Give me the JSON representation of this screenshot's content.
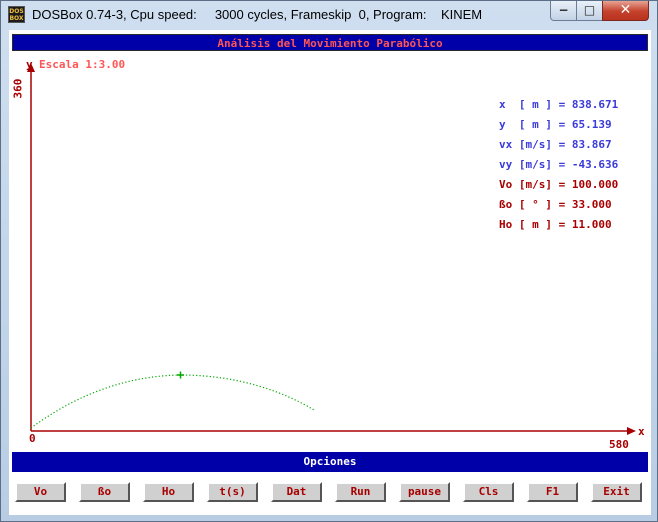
{
  "window": {
    "icon_text": "DOS BOX",
    "title": "DOSBox 0.74-3, Cpu speed:     3000 cycles, Frameskip  0, Program:    KINEM",
    "controls": [
      "minimize",
      "maximize",
      "close"
    ],
    "minimize_glyph": "−",
    "maximize_glyph": "□",
    "close_glyph": "✕"
  },
  "app": {
    "title": "Análisis del Movimiento Parabólico",
    "scale": "Escala 1:3.00",
    "y_axis_label": "y",
    "y_max_label": "360",
    "x_axis_label": "x",
    "x_max_label": "580",
    "origin_label": "0",
    "options_title": "Opciones"
  },
  "readouts": [
    {
      "label": "x  [ m ] = 838.671",
      "color": "blue"
    },
    {
      "label": "y  [ m ] = 65.139",
      "color": "blue"
    },
    {
      "label": "vx [m/s] = 83.867",
      "color": "blue"
    },
    {
      "label": "vy [m/s] = -43.636",
      "color": "blue"
    },
    {
      "label": "Vo [m/s] = 100.000",
      "color": "red"
    },
    {
      "label": "ßo [ ° ] = 33.000",
      "color": "red"
    },
    {
      "label": "Ho [ m ] = 11.000",
      "color": "red"
    }
  ],
  "buttons": [
    "Vo",
    "ßo",
    "Ho",
    "t(s)",
    "Dat",
    "Run",
    "pause",
    "Cls",
    "F1",
    "Exit"
  ],
  "colors": {
    "axis": "#a80000",
    "trajectory": "#00a800",
    "bar": "#0000a8",
    "title_text": "#ff5555",
    "readout_blue": "#3a3adb",
    "readout_red": "#a80000"
  }
}
